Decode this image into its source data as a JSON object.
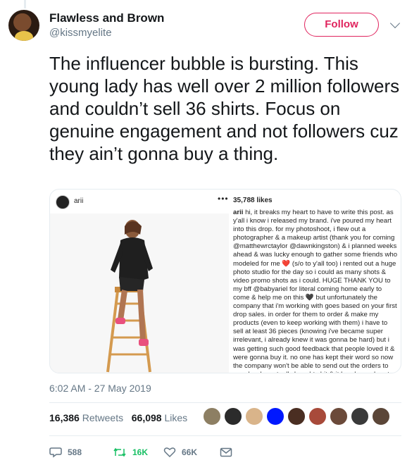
{
  "author": {
    "name": "Flawless and Brown",
    "handle": "@kissmyelite",
    "follow_label": "Follow"
  },
  "tweet": {
    "text": "The influencer bubble is bursting. This young lady has well over 2 million followers and couldn’t sell 36 shirts. Focus on genuine engagement and not followers cuz they ain’t gonna buy a thing.",
    "timestamp": "6:02 AM - 27 May 2019"
  },
  "embedded_post": {
    "username": "arii",
    "likes": "35,788 likes",
    "caption_user": "arii",
    "caption": " hi, it breaks my heart to have to write this post. as y'all i know i released my brand. i've poured my heart into this drop. for my photoshoot, i flew out a photographer & a makeup artist (thank you for coming @matthewrctaylor @dawnkingston) & i planned weeks ahead & was lucky enough to gather some friends who modeled for me ❤️ (s/o to y'all too) i rented out a huge photo studio for the day so i could as many shots & video promo shots as i could. HUGE THANK YOU to my bff @babyariel for literal coming home early to come & help me on this 🖤 but unfortunately the company that i'm working with goes based on your first drop sales. in order for them to order & make my products (even to keep working with them) i have to sell at least 36 pieces (knowing i've became super irrelevant, i already knew it was gonna be hard) but i was getting such good feedback that people loved it & were gonna buy it. no one has kept their word so now the company won't be able to send out the orders to people who actually bought shit & it breaks my heart (don't worry you'll get a refund). i sent out PR packages to friends but i didn't"
  },
  "stats": {
    "retweets_count": "16,386",
    "retweets_label": "Retweets",
    "likes_count": "66,098",
    "likes_label": "Likes"
  },
  "actions": {
    "reply_count": "588",
    "retweet_count": "16K",
    "like_count": "66K"
  },
  "colors": {
    "follow": "#e0245e",
    "retweet": "#17bf63",
    "secondary_text": "#657786"
  },
  "icons": [
    "chevron-down-icon",
    "reply-icon",
    "retweet-icon",
    "heart-icon",
    "message-icon"
  ]
}
